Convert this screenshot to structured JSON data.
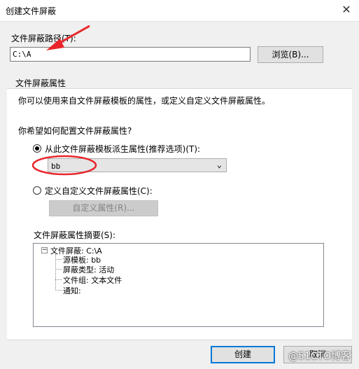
{
  "window": {
    "title": "创建文件屏蔽",
    "close_glyph": "✕"
  },
  "path": {
    "label": "文件屏蔽路径(T):",
    "value": "C:\\A",
    "browse_button": "浏览(B)..."
  },
  "properties": {
    "group_title": "文件屏蔽属性",
    "description": "你可以使用来自文件屏蔽模板的属性，或定义自定义文件屏蔽属性。",
    "question": "你希望如何配置文件屏蔽属性?",
    "option_template": "从此文件屏蔽模板派生属性(推荐选项)(T):",
    "template_selected": "bb",
    "option_custom": "定义自定义文件屏蔽属性(C):",
    "custom_button": "自定义属性(R)...",
    "summary_label": "文件屏蔽属性摘要(S):",
    "summary_tree": {
      "root": "文件屏蔽: C:\\A",
      "children": [
        "源模板: bb",
        "屏蔽类型: 活动",
        "文件组: 文本文件",
        "通知:"
      ]
    }
  },
  "footer": {
    "create_button": "创建",
    "cancel_button": "取消"
  },
  "watermark": "@51CTO博客",
  "icons": {
    "expander": "minus-box-icon",
    "dropdown": "chevron-down-icon",
    "close": "close-icon"
  },
  "annotations": {
    "arrow_color": "#e8262b",
    "ellipse_color": "#e8262b"
  }
}
